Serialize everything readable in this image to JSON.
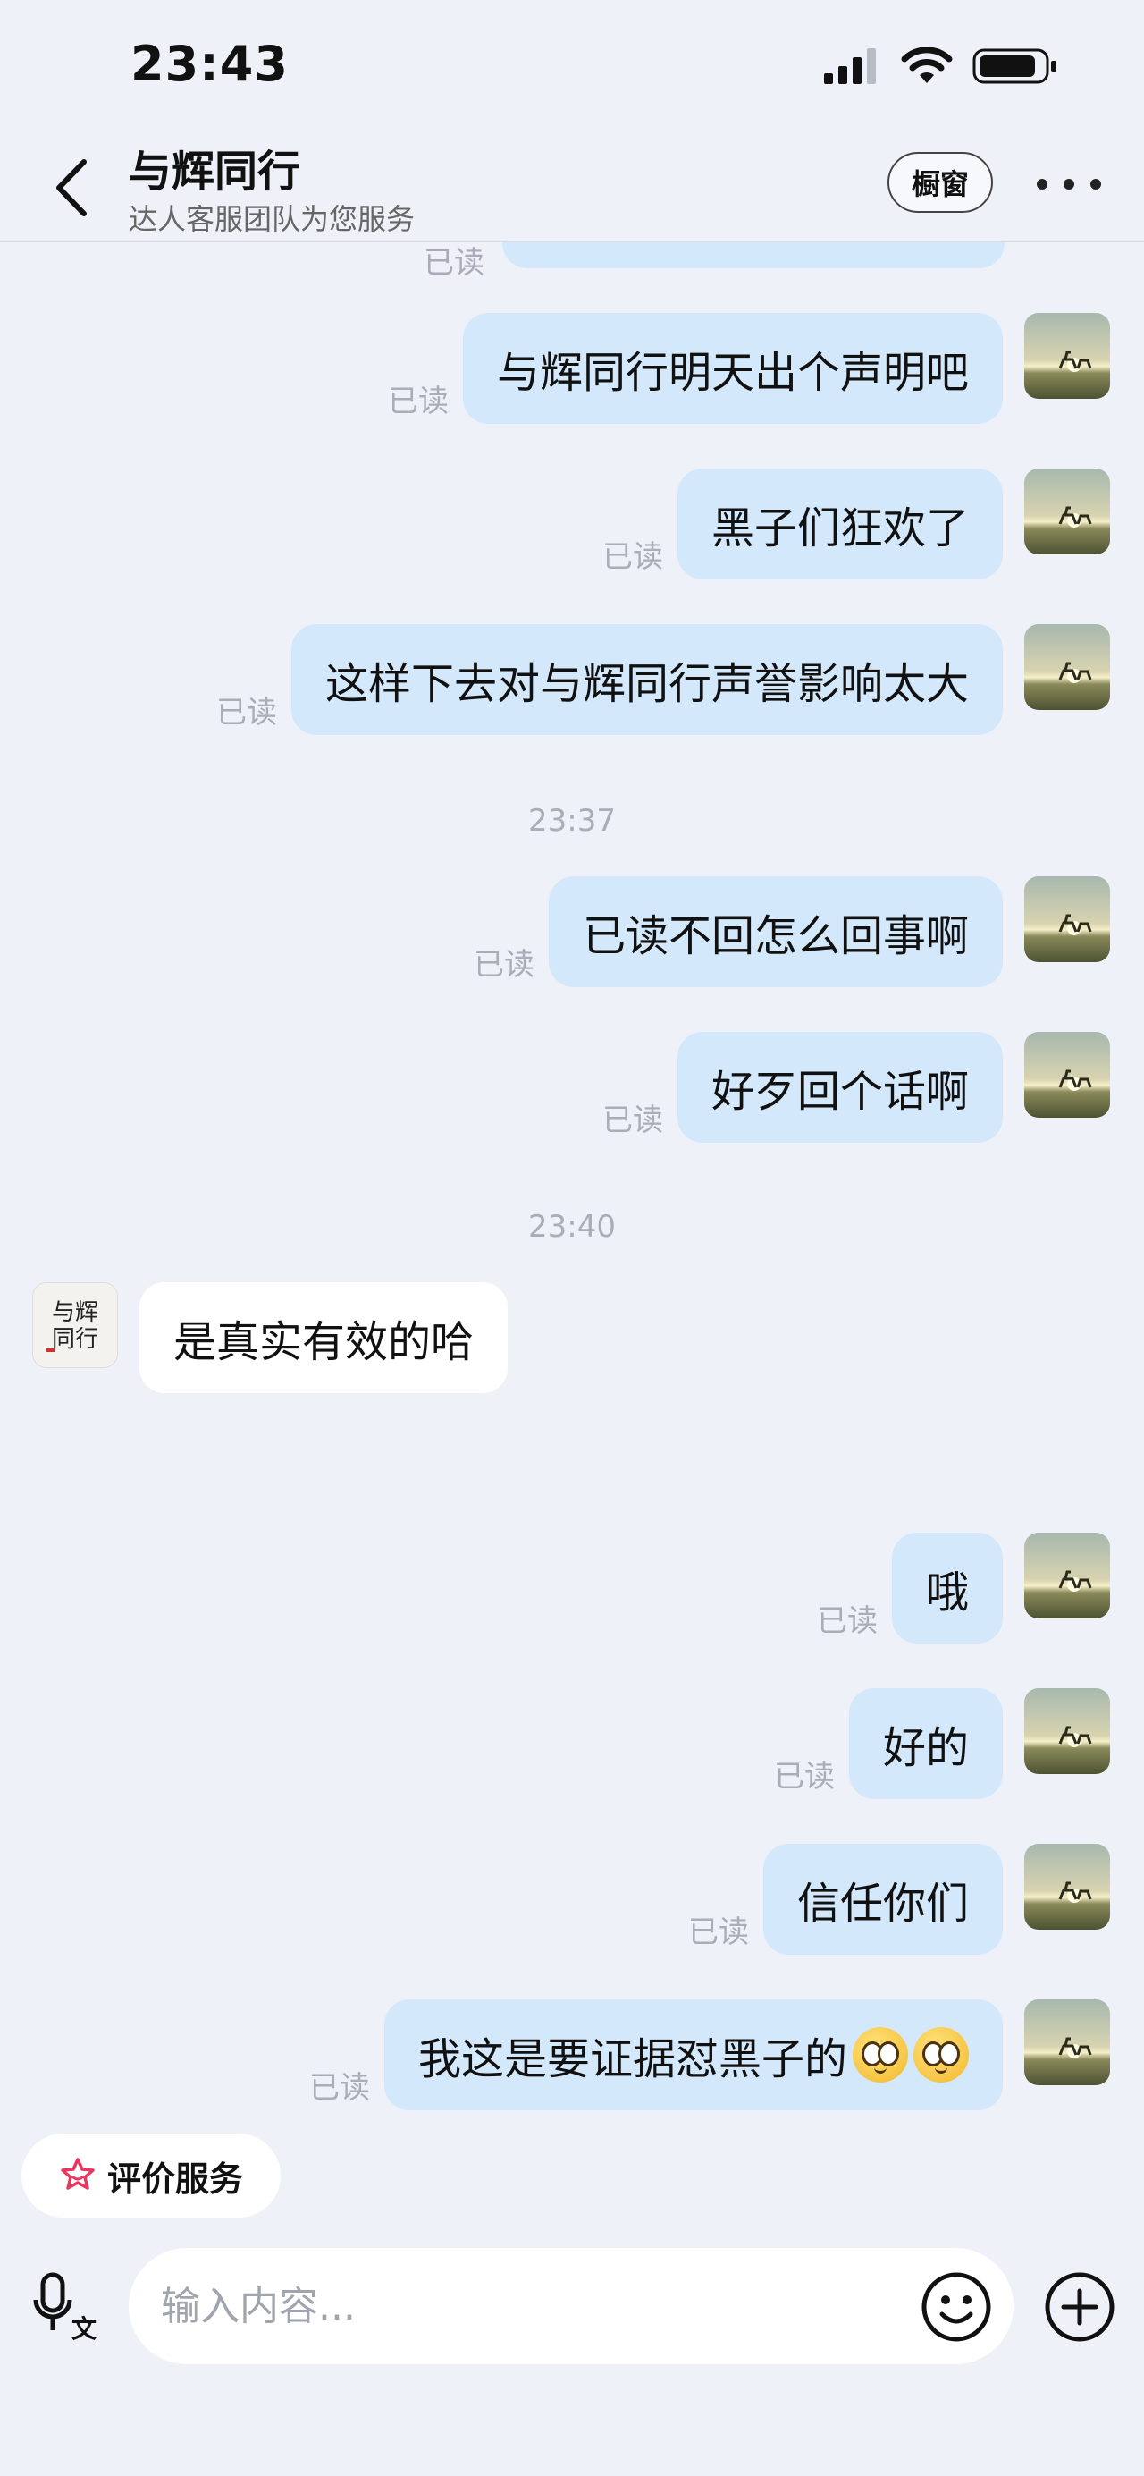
{
  "status_bar": {
    "time": "23:43"
  },
  "header": {
    "title": "与辉同行",
    "subtitle": "达人客服团队为您服务",
    "showcase_label": "橱窗"
  },
  "read_label": "已读",
  "messages": [
    {
      "text": "与辉同行明天出个声明吧",
      "read": "已读"
    },
    {
      "text": "黑子们狂欢了",
      "read": "已读"
    },
    {
      "text": "这样下去对与辉同行声誉影响太大",
      "read": "已读"
    },
    {
      "text": "已读不回怎么回事啊",
      "read": "已读"
    },
    {
      "text": "好歹回个话啊",
      "read": "已读"
    },
    {
      "text": "是真实有效的哈"
    },
    {
      "text": "哦",
      "read": "已读"
    },
    {
      "text": "好的",
      "read": "已读"
    },
    {
      "text": "信任你们",
      "read": "已读"
    },
    {
      "text": "我这是要证据怼黑子的",
      "read": "已读",
      "emojis": [
        "smile-emoji",
        "smile-emoji"
      ]
    }
  ],
  "timestamps": [
    "23:37",
    "23:40"
  ],
  "shop_avatar_text": "与辉同行",
  "rate_service_label": "评价服务",
  "input": {
    "placeholder": "输入内容..."
  },
  "voice_text_badge": "文",
  "colors": {
    "background": "#eef2f8",
    "outgoing_bubble": "#d4e8fb",
    "incoming_bubble": "#ffffff",
    "rate_icon": "#e8365d"
  }
}
